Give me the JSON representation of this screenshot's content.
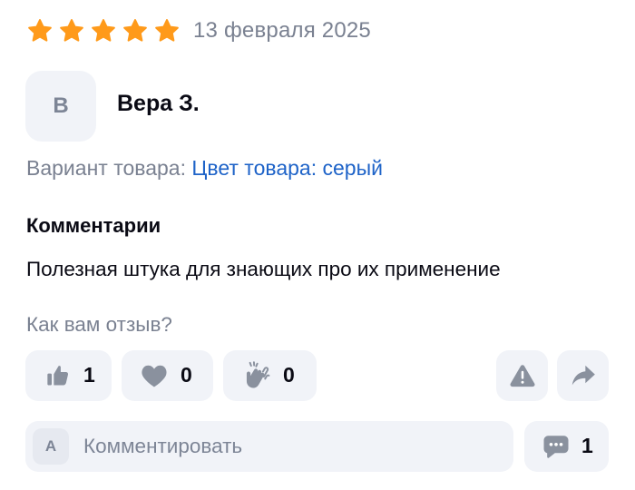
{
  "review": {
    "rating": 5,
    "rating_max": 5,
    "star_color": "#ff9a1a",
    "date": "13 февраля 2025",
    "author": {
      "initial": "В",
      "name": "Вера З."
    },
    "variant": {
      "label": "Вариант товара:",
      "value": "Цвет товара: серый"
    },
    "comments_heading": "Комментарии",
    "comment_text": "Полезная штука для знающих про их применение"
  },
  "feedback": {
    "question": "Как вам отзыв?",
    "likes": "1",
    "hearts": "0",
    "claps": "0",
    "icons": {
      "like": "thumbs-up-icon",
      "heart": "heart-icon",
      "clap": "clapping-hands-icon",
      "report": "warning-icon",
      "share": "share-arrow-icon"
    }
  },
  "comment_box": {
    "avatar_initial": "А",
    "placeholder": "Комментировать",
    "comments_count": "1",
    "icon": "comment-bubble-icon"
  },
  "colors": {
    "accent_link": "#1e63c8",
    "muted_text": "#7a8191",
    "pill_bg": "#f1f3f8",
    "icon_gray": "#8a919e"
  }
}
